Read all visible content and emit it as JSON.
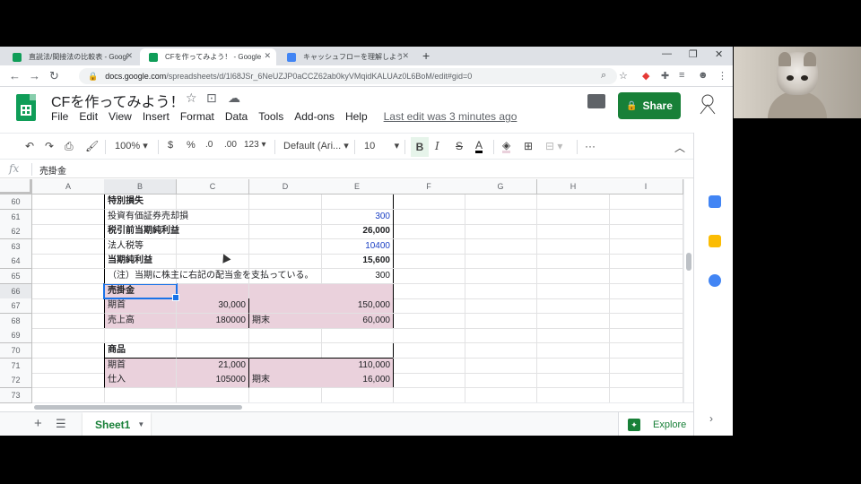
{
  "browser": {
    "tabs": [
      {
        "label": "直説法/間接法の比較表 - Google",
        "favicon_color": "#0f9d58",
        "active": false
      },
      {
        "label": "CFを作ってみよう！ - Google Sheet",
        "favicon_color": "#0f9d58",
        "active": true
      },
      {
        "label": "キャッシュフローを理解しよう - Google",
        "favicon_color": "#4285f4",
        "active": false
      }
    ],
    "new_tab": "+",
    "url_domain": "docs.google.com",
    "url_path": "/spreadsheets/d/1l68JSr_6NeUZJP0aCCZ62ab0kyVMqidKALUAz0L6BoM/edit#gid=0"
  },
  "doc": {
    "title": "CFを作ってみよう！",
    "menu": [
      "File",
      "Edit",
      "View",
      "Insert",
      "Format",
      "Data",
      "Tools",
      "Add-ons",
      "Help"
    ],
    "last_edit": "Last edit was 3 minutes ago",
    "share_label": "Share"
  },
  "toolbar": {
    "zoom": "100%",
    "currency": "$",
    "percent": "%",
    "dec_decrease": ".0",
    "dec_increase": ".00",
    "more_formats": "123",
    "font": "Default (Ari...",
    "font_size": "10",
    "bold": "B",
    "italic": "I",
    "strike": "S",
    "text_color": "A",
    "more": "···"
  },
  "formula_bar": {
    "fx": "fx",
    "value": "売掛金"
  },
  "columns": [
    "A",
    "B",
    "C",
    "D",
    "E",
    "F",
    "G",
    "H",
    "I"
  ],
  "rows": [
    {
      "n": "60",
      "cells": {
        "B": "特別損失"
      }
    },
    {
      "n": "61",
      "cells": {
        "B": "投資有価証券売却損",
        "E": "300"
      }
    },
    {
      "n": "62",
      "cells": {
        "B": "税引前当期純利益",
        "E": "26,000"
      }
    },
    {
      "n": "63",
      "cells": {
        "B": "法人税等",
        "E": "10400"
      }
    },
    {
      "n": "64",
      "cells": {
        "B": "当期純利益",
        "E": "15,600"
      }
    },
    {
      "n": "65",
      "cells": {
        "B": "（注）当期に株主に右記の配当金を支払っている。",
        "E": "300"
      }
    },
    {
      "n": "66",
      "cells": {
        "B": "売掛金"
      }
    },
    {
      "n": "67",
      "cells": {
        "B": "期首",
        "C": "30,000",
        "E": "150,000"
      }
    },
    {
      "n": "68",
      "cells": {
        "B": "売上高",
        "C": "180000",
        "D": "期末",
        "E": "60,000"
      }
    },
    {
      "n": "69",
      "cells": {}
    },
    {
      "n": "70",
      "cells": {
        "B": "商品"
      }
    },
    {
      "n": "71",
      "cells": {
        "B": "期首",
        "C": "21,000",
        "E": "110,000"
      }
    },
    {
      "n": "72",
      "cells": {
        "B": "仕入",
        "C": "105000",
        "D": "期末",
        "E": "16,000"
      }
    },
    {
      "n": "73",
      "cells": {}
    }
  ],
  "sheet_tab": "Sheet1",
  "explore_label": "Explore",
  "colors": {
    "accent_green": "#188038",
    "pink_fill": "#ead1dc",
    "blue_text": "#1a3fc4",
    "selection": "#1a73e8"
  }
}
